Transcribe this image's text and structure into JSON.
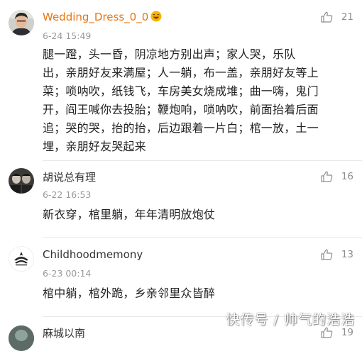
{
  "comments": [
    {
      "username": "Wedding_Dress_0_0",
      "timestamp": "6-24 15:49",
      "likes": "21",
      "lines": [
        "腿一蹬，头一昏，阴凉地方别出声；家人哭，乐队",
        "出，亲朋好友来满屋；人一躺，布一盖，亲朋好友等上",
        "菜；唢呐吹，纸钱飞，车房美女烧成堆；曲一嗨，鬼门",
        "开，阎王喊你去投胎；鞭炮响，唢呐吹，前面抬着后面",
        "追；哭的哭，抬的抬，后边跟着一片白；棺一放，土一",
        "埋，亲朋好友哭起来"
      ]
    },
    {
      "username": "胡说总有理",
      "timestamp": "6-22 16:53",
      "likes": "16",
      "lines": [
        "新衣穿，棺里躺，年年清明放炮仗"
      ]
    },
    {
      "username": "Childhoodmemony",
      "timestamp": "6-23 00:14",
      "likes": "13",
      "lines": [
        "棺中躺，棺外跪，乡亲邻里众皆醉"
      ]
    },
    {
      "username": "麻城以南",
      "likes": "19"
    }
  ],
  "watermark": "快传号 / 帅气的浩浩",
  "colors": {
    "accent_username": "#e8750d",
    "username": "#333333",
    "timestamp": "#9a9a9a",
    "body": "#222222"
  },
  "icons": {
    "like": "thumbs-up-outline-icon",
    "badge": "laughing-emoji-icon"
  }
}
